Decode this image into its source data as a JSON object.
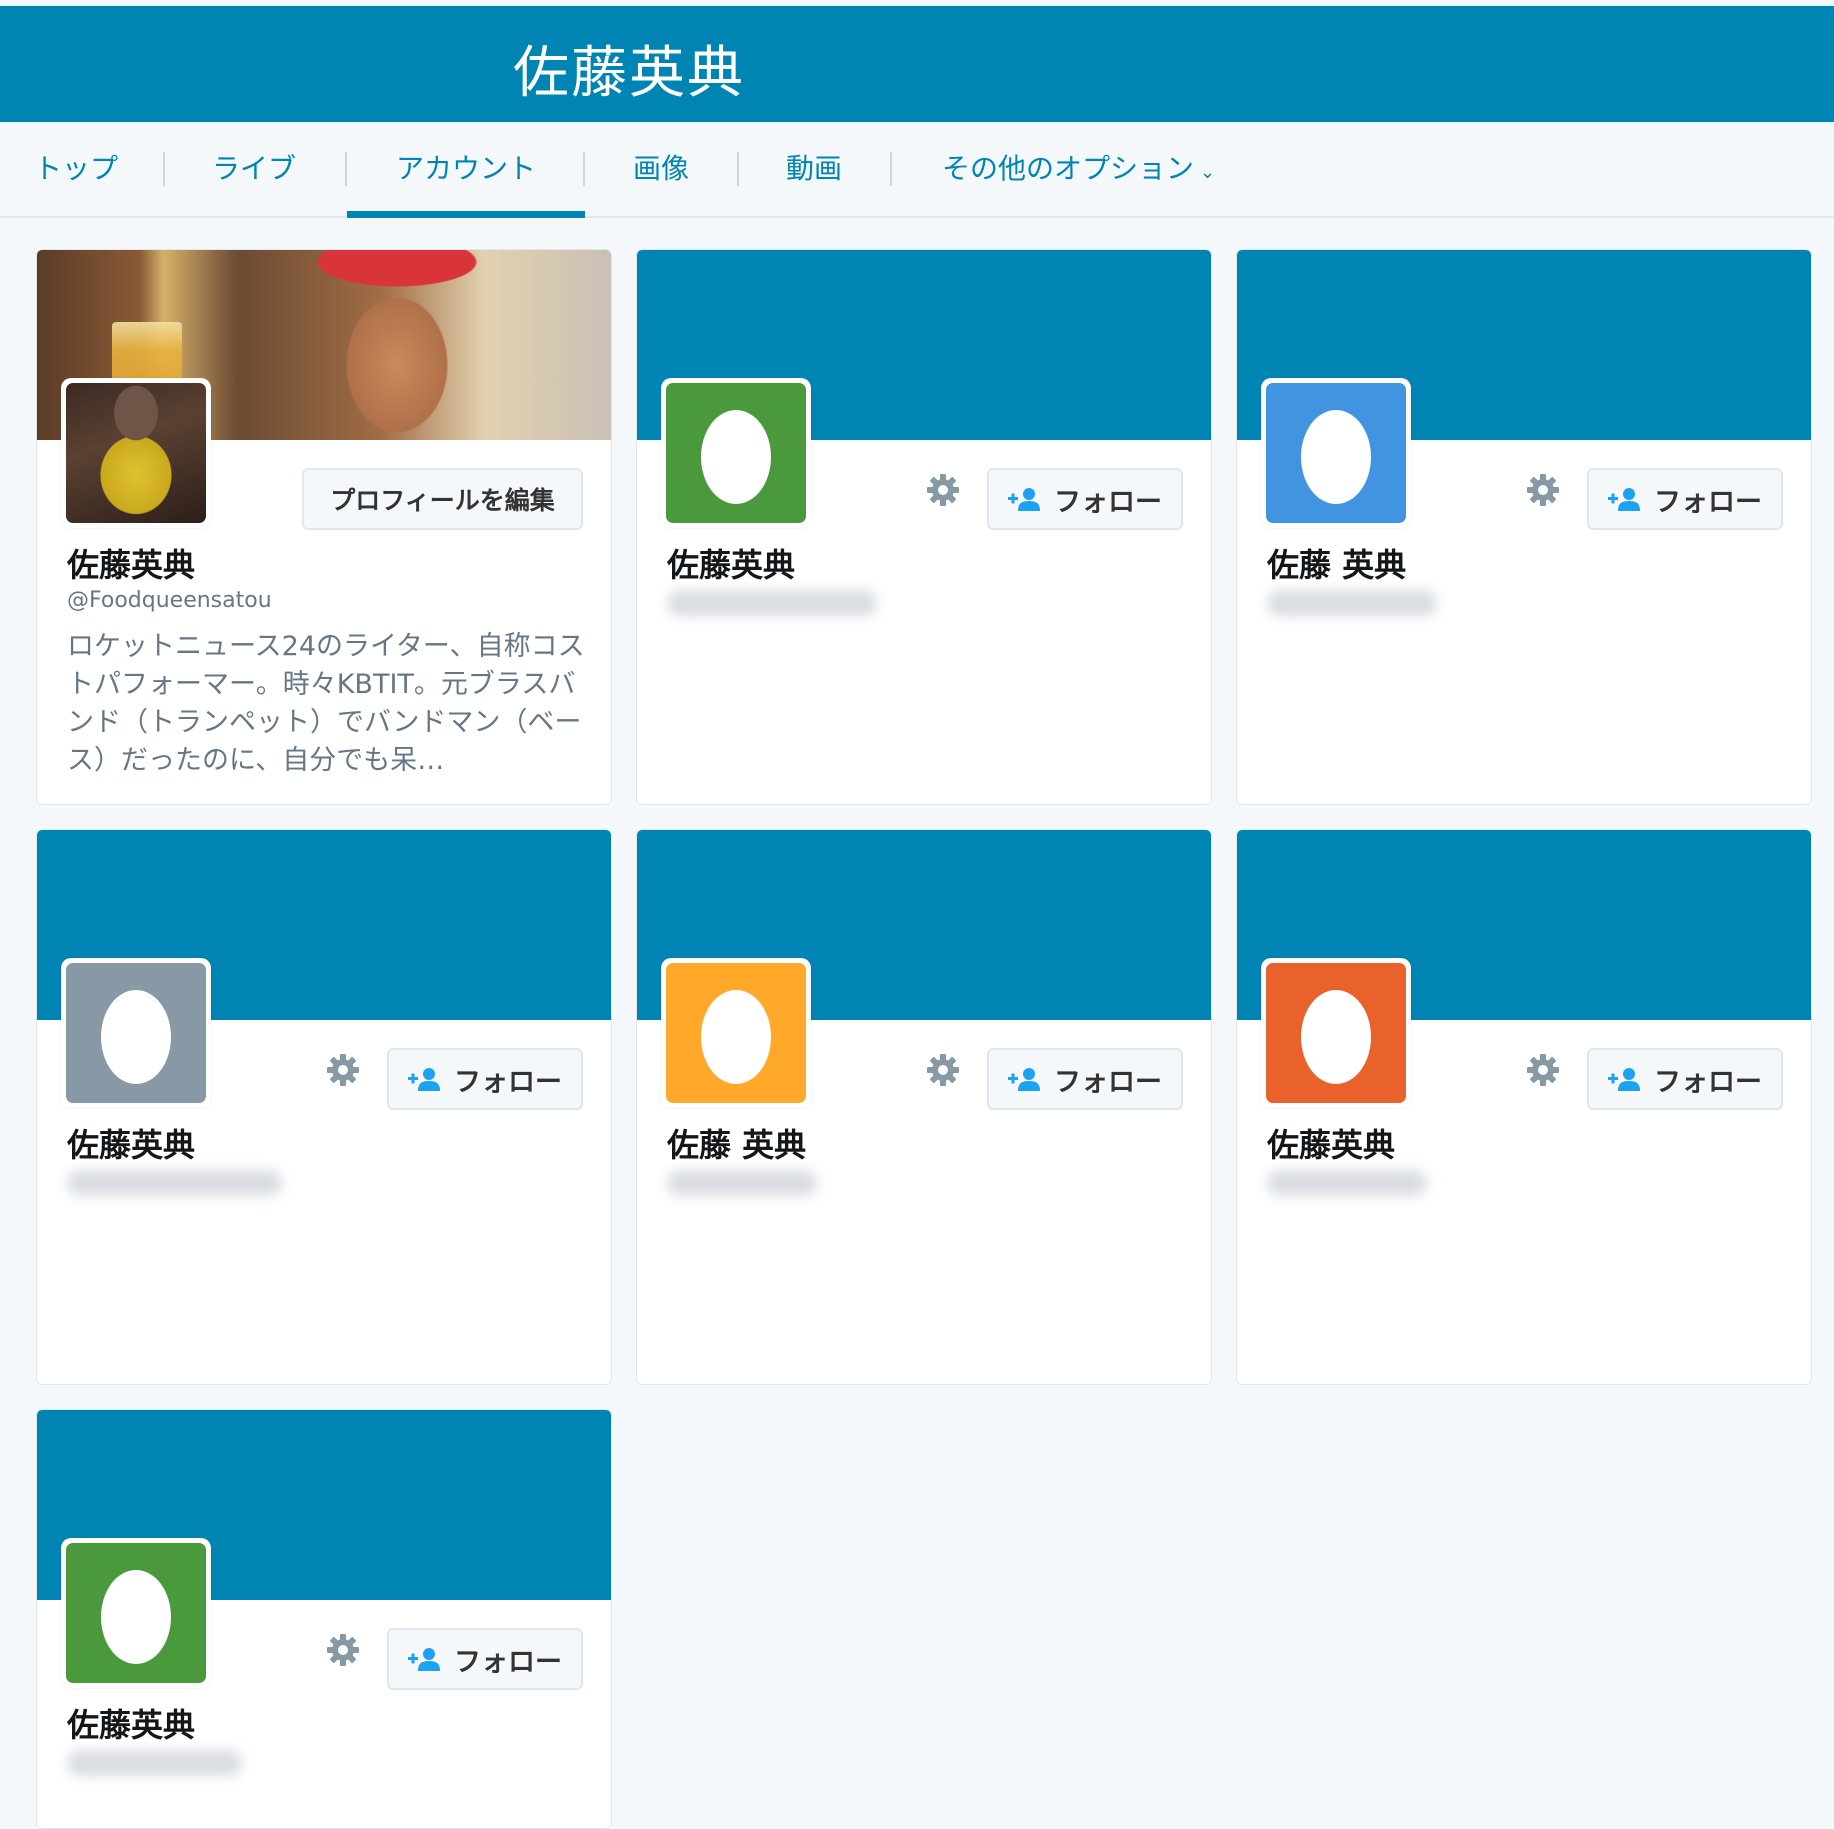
{
  "header": {
    "title": "佐藤英典"
  },
  "nav": {
    "tabs": [
      {
        "label": "トップ"
      },
      {
        "label": "ライブ"
      },
      {
        "label": "アカウント"
      },
      {
        "label": "画像"
      },
      {
        "label": "動画"
      },
      {
        "label": "その他のオプション"
      }
    ],
    "active": "アカウント"
  },
  "colors": {
    "brand": "#0084b4",
    "egg_green": "#4a9a3d",
    "egg_blue": "#4194df",
    "egg_gray": "#8899a6",
    "egg_orange": "#ffa829",
    "egg_red": "#e9612b"
  },
  "profile_card": {
    "name": "佐藤英典",
    "handle": "@Foodqueensatou",
    "bio": "ロケットニュース24のライター、自称コストパフォーマー。時々KBTIT。元ブラスバンド（トランペット）でバンドマン（ベース）だったのに、自分でも呆…",
    "edit_label": "プロフィールを編集"
  },
  "cards": [
    {
      "name": "佐藤英典",
      "avatar_icon": "egg-avatar-icon",
      "avatar_color": "egg_green",
      "follow_label": "フォロー"
    },
    {
      "name": "佐藤 英典",
      "avatar_icon": "egg-avatar-icon",
      "avatar_color": "egg_blue",
      "follow_label": "フォロー"
    },
    {
      "name": "佐藤英典",
      "avatar_icon": "egg-avatar-icon",
      "avatar_color": "egg_gray",
      "follow_label": "フォロー"
    },
    {
      "name": "佐藤 英典",
      "avatar_icon": "egg-avatar-icon",
      "avatar_color": "egg_orange",
      "follow_label": "フォロー"
    },
    {
      "name": "佐藤英典",
      "avatar_icon": "egg-avatar-icon",
      "avatar_color": "egg_red",
      "follow_label": "フォロー"
    },
    {
      "name": "佐藤英典",
      "avatar_icon": "egg-avatar-icon",
      "avatar_color": "egg_green",
      "follow_label": "フォロー"
    }
  ]
}
